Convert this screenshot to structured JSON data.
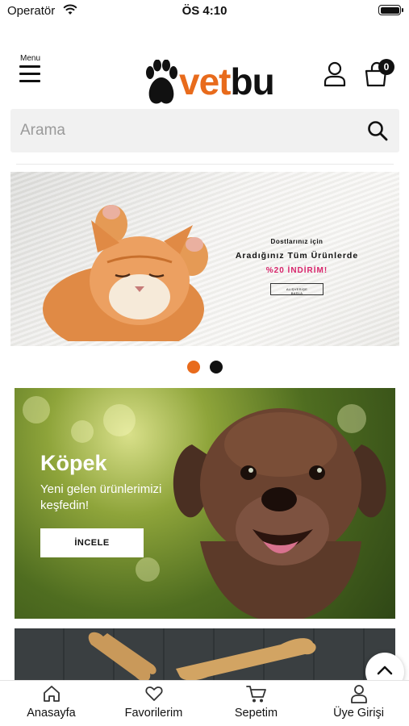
{
  "status_bar": {
    "carrier": "Operatör",
    "time": "ÖS 4:10"
  },
  "header": {
    "menu_label": "Menu",
    "logo": {
      "part1": "vet",
      "part2": "bu"
    },
    "cart_count": "0"
  },
  "search": {
    "placeholder": "Arama",
    "value": ""
  },
  "banner": {
    "line1": "Dostlarınız için",
    "line2": "Aradığınız Tüm Ürünlerde",
    "line3": "%20 İNDİRİM!",
    "button": "ALIŞVERİŞE BAŞLA",
    "slide_count": 2,
    "active_slide": 1
  },
  "category_card": {
    "title": "Köpek",
    "subtitle": "Yeni gelen ürünlerimizi keşfedin!",
    "button": "İNCELE"
  },
  "tabbar": {
    "items": [
      {
        "label": "Anasayfa",
        "icon": "home-icon"
      },
      {
        "label": "Favorilerim",
        "icon": "heart-icon"
      },
      {
        "label": "Sepetim",
        "icon": "cart-icon"
      },
      {
        "label": "Üye Girişi",
        "icon": "user-icon"
      }
    ]
  },
  "colors": {
    "accent": "#e86b1c",
    "discount": "#d8246b",
    "text": "#111111"
  }
}
